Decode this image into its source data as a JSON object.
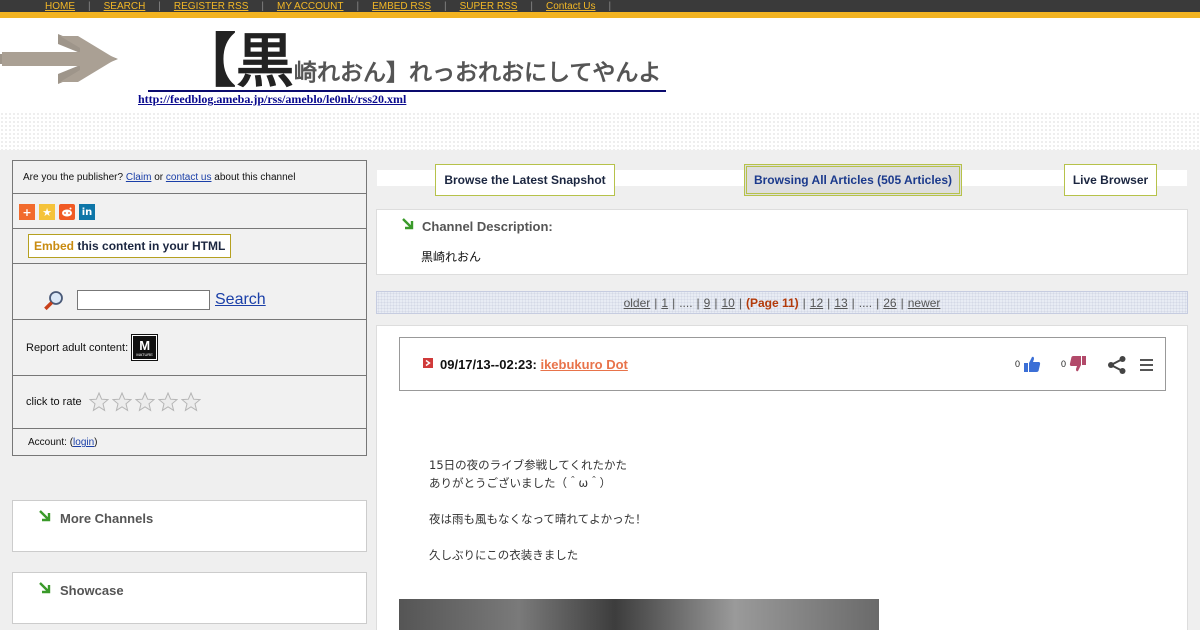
{
  "topnav": {
    "items": [
      "HOME",
      "SEARCH",
      "REGISTER RSS",
      "MY ACCOUNT",
      "EMBED RSS",
      "SUPER RSS",
      "Contact Us"
    ]
  },
  "header": {
    "title_prefix": "【黒",
    "title_rest": "崎れおん】れっおれおにしてやんよ",
    "feed_url": "http://feedblog.ameba.jp/rss/ameblo/le0nk/rss20.xml"
  },
  "sidebar": {
    "publisher_text_1": "Are you the publisher?",
    "claim": "Claim",
    "or": "or",
    "contact_us": "contact us",
    "publisher_text_2": "about this channel",
    "embed_highlight": "Embed",
    "embed_rest": " this content in your HTML",
    "search_placeholder": "",
    "search_label": "Search",
    "report_adult": "Report adult content:",
    "mature_badge_letter": "M",
    "mature_badge_text": "MATURE",
    "click_to_rate": "click to rate",
    "rating_stars_filled": 0,
    "account_prefix": "Account: (",
    "login": "login",
    "account_suffix": ")"
  },
  "boxes": {
    "more_channels": "More Channels",
    "showcase": "Showcase"
  },
  "tabs": {
    "snapshot": "Browse the Latest Snapshot",
    "all_articles": "Browsing All Articles (505 Articles)",
    "live": "Live Browser"
  },
  "description": {
    "title": "Channel Description:",
    "text": "黒崎れおん"
  },
  "pager": {
    "older": "older",
    "p1": "1",
    "dots1": "....",
    "p9": "9",
    "p10": "10",
    "current": "(Page 11)",
    "p12": "12",
    "p13": "13",
    "dots2": "....",
    "p26": "26",
    "newer": "newer"
  },
  "article": {
    "date": "09/17/13--02:23: ",
    "title": "ikebukuro Dot",
    "likes": "0",
    "dislikes": "0",
    "body": [
      "15日の夜のライブ参戦してくれたかた",
      "ありがとうございました（＾ω＾）",
      "",
      "夜は雨も風もなくなって晴れてよかった！",
      "",
      "久しぶりにこの衣装きました"
    ]
  },
  "colors": {
    "topbar": "#3a3a3a",
    "gold": "#f2b321",
    "link": "#1a3fa8",
    "article_link": "#e8734a",
    "thumb_up": "#3b6fd6",
    "thumb_down": "#b24a6a",
    "current_page": "#b33a0a"
  }
}
